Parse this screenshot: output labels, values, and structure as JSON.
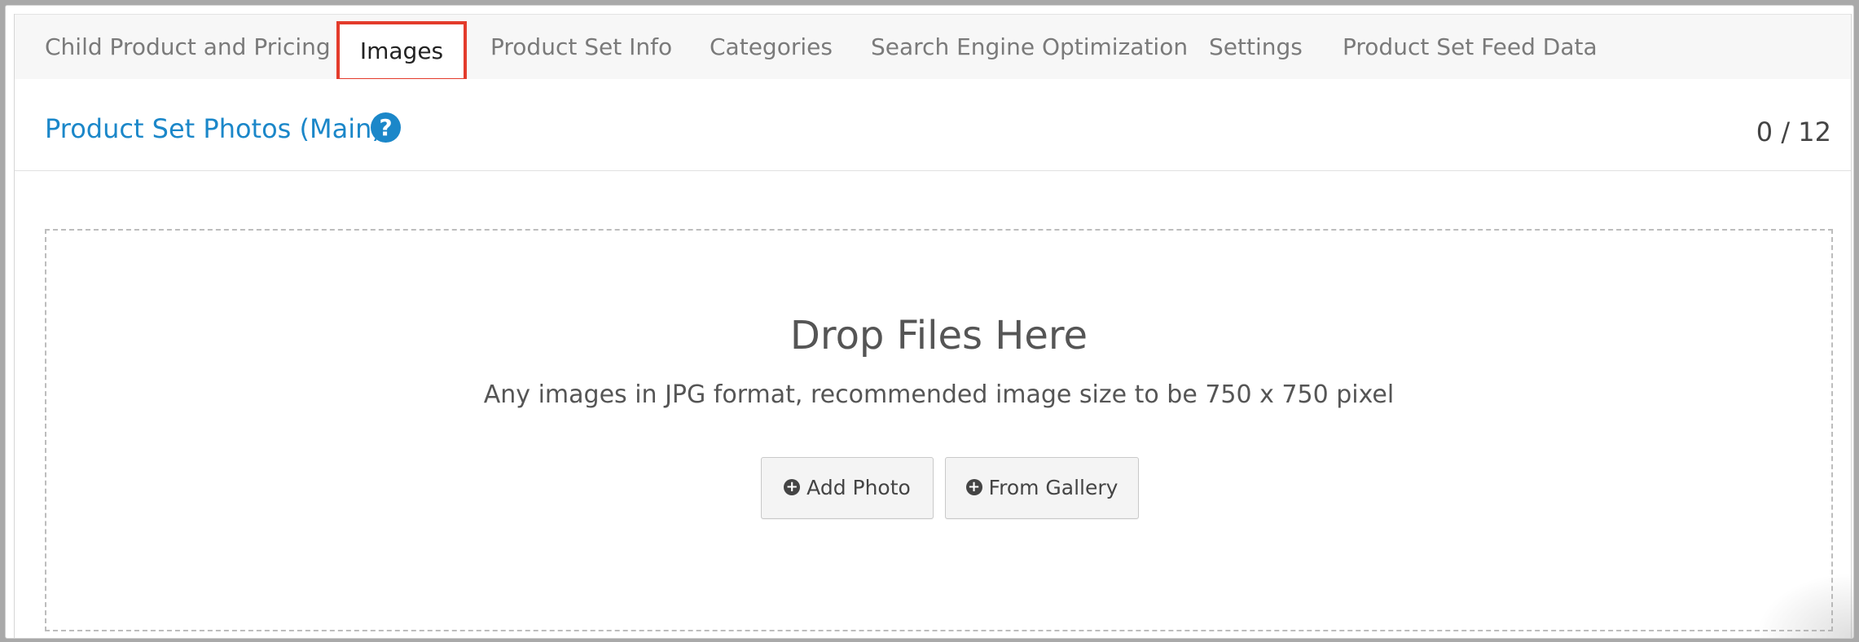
{
  "tabs": [
    {
      "label": "Child Product and Pricing",
      "active": false
    },
    {
      "label": "Images",
      "active": true
    },
    {
      "label": "Product Set Info",
      "active": false
    },
    {
      "label": "Categories",
      "active": false
    },
    {
      "label": "Search Engine Optimization",
      "active": false
    },
    {
      "label": "Settings",
      "active": false
    },
    {
      "label": "Product Set Feed Data",
      "active": false
    }
  ],
  "section": {
    "title": "Product Set Photos (Main)",
    "help_icon": "question-circle-icon",
    "count": "0 / 12"
  },
  "dropzone": {
    "title": "Drop Files Here",
    "subtitle": "Any images in JPG format, recommended image size to be 750 x 750 pixel",
    "add_photo_label": "Add Photo",
    "from_gallery_label": "From Gallery",
    "button_icon": "plus-circle-icon"
  },
  "colors": {
    "accent": "#1b87c9",
    "highlight_border": "#e33b2b",
    "tab_text": "#7a7a7a"
  }
}
